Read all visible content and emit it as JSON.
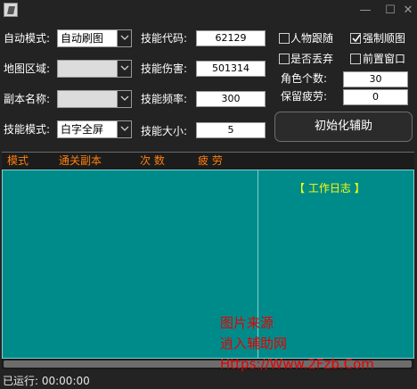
{
  "window": {
    "minimize": "—",
    "maximize": "☐",
    "close": "✕"
  },
  "left_column": {
    "auto_mode": {
      "label": "自动模式:",
      "value": "自动刷图"
    },
    "map_area": {
      "label": "地图区域:",
      "value": ""
    },
    "dungeon_name": {
      "label": "副本名称:",
      "value": ""
    },
    "skill_mode": {
      "label": "技能模式:",
      "value": "白字全屏"
    }
  },
  "mid_column": {
    "skill_code": {
      "label": "技能代码:",
      "value": "62129"
    },
    "skill_damage": {
      "label": "技能伤害:",
      "value": "501314"
    },
    "skill_freq": {
      "label": "技能频率:",
      "value": "300"
    },
    "skill_size": {
      "label": "技能大小:",
      "value": "5"
    }
  },
  "right_column": {
    "follow": {
      "label": "人物跟随",
      "checked": false
    },
    "force_stick": {
      "label": "强制顺图",
      "checked": true
    },
    "discard": {
      "label": "是否丢弃",
      "checked": false
    },
    "front_window": {
      "label": "前置窗口",
      "checked": false
    },
    "role_count": {
      "label": "角色个数:",
      "value": "30"
    },
    "keep_fatigue": {
      "label": "保留疲劳:",
      "value": "0"
    },
    "init_button": "初始化辅助"
  },
  "list": {
    "columns": [
      "模式",
      "通关副本",
      "次 数",
      "疲 劳"
    ],
    "log_title": "【 工作日志 】"
  },
  "status": {
    "runtime": "已运行: 00:00:00"
  },
  "watermark": [
    "图片来源",
    "逍入辅助网",
    "Https://Www.2Fzb.Com"
  ],
  "colors": {
    "accent_orange": "#ff7f0e",
    "list_bg": "#008b8b",
    "log_title": "#ffff00",
    "watermark": "#e60000"
  }
}
